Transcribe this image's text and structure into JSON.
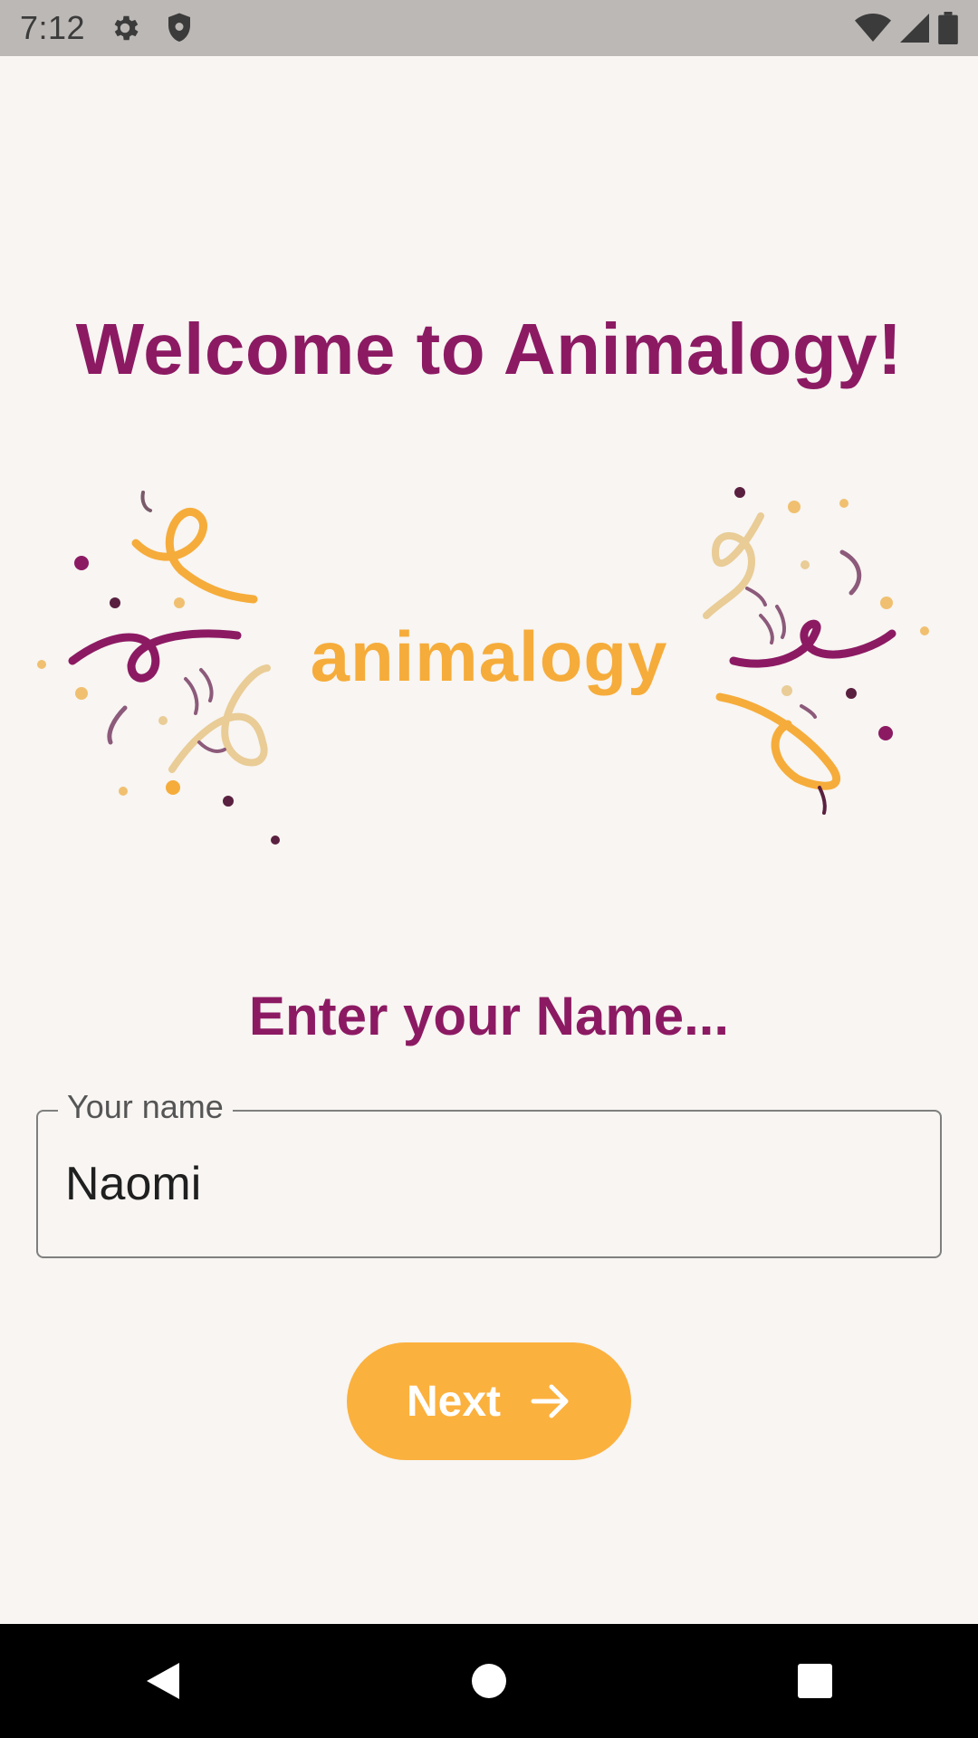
{
  "status_bar": {
    "time": "7:12",
    "icons_left": [
      "gear-icon",
      "shield-icon"
    ],
    "icons_right": [
      "wifi-icon",
      "signal-icon",
      "battery-icon"
    ]
  },
  "welcome": {
    "title": "Welcome to Animalogy!"
  },
  "logo": {
    "wordmark": "animalogy",
    "colors": {
      "wordmark": "#f6ac3a",
      "accent": "#c94f9b",
      "confetti_plum": "#8c1a63",
      "confetti_orange": "#f6ac3a",
      "confetti_beige": "#e9cc96"
    }
  },
  "name_form": {
    "prompt": "Enter your Name...",
    "field_label": "Your name",
    "field_value": "Naomi"
  },
  "next_button": {
    "label": "Next",
    "icon": "arrow-right-icon",
    "color": "#fbb13e"
  },
  "nav_bar": {
    "buttons": [
      "back-icon",
      "home-icon",
      "recents-icon"
    ]
  },
  "theme": {
    "background": "#f8f5f2",
    "primary": "#8c1a63"
  }
}
